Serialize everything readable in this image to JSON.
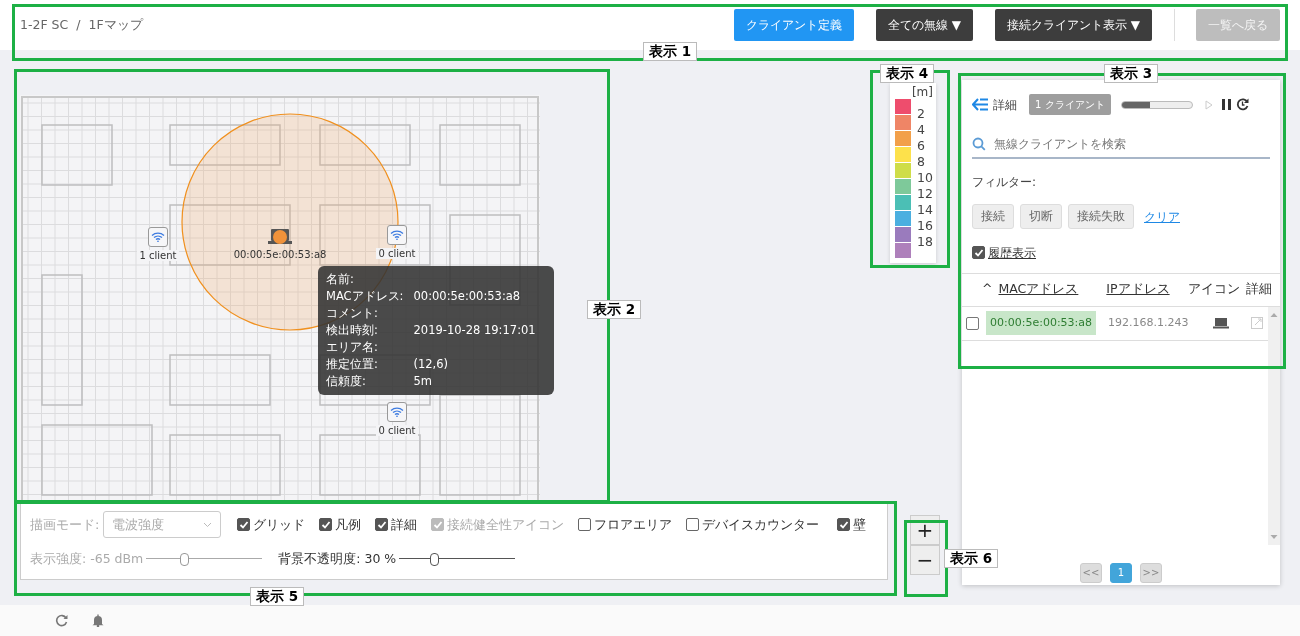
{
  "breadcrumb": {
    "separator": "/",
    "items": [
      {
        "label": "1-2F SC"
      },
      {
        "label": "1Fマップ"
      }
    ]
  },
  "toolbar": [
    {
      "label": "クライアント定義",
      "kind": "primary",
      "disabled": false
    },
    {
      "label": "全ての無線 ▼",
      "kind": "dropdown",
      "disabled": false
    },
    {
      "label": "接続クライアント表示 ▼",
      "kind": "dropdown",
      "disabled": false
    },
    {
      "label": "一覧へ戻る",
      "kind": "plain",
      "disabled": true
    }
  ],
  "map": {
    "access_points": [
      {
        "label": "1 client"
      },
      {
        "label": "0 client"
      },
      {
        "label": "0 client"
      }
    ],
    "client": {
      "label": "00:00:5e:00:53:a8"
    },
    "tooltip": [
      {
        "key": "名前:"
      },
      {
        "key": "MACアドレス:",
        "value": "00:00:5e:00:53:a8"
      },
      {
        "key": "コメント:"
      },
      {
        "key": "検出時刻:",
        "value": "2019-10-28 19:17:01"
      },
      {
        "key": "エリア名:"
      },
      {
        "key": "推定位置:",
        "value": "(12,6)"
      },
      {
        "key": "信頼度:",
        "value": "5m"
      }
    ]
  },
  "legend": {
    "unit": "[m]",
    "items": [
      {
        "label": "2",
        "color": "#ee4d6d"
      },
      {
        "label": "4",
        "color": "#ef8566"
      },
      {
        "label": "6",
        "color": "#f2a04a"
      },
      {
        "label": "8",
        "color": "#fde14b"
      },
      {
        "label": "10",
        "color": "#cfdd48"
      },
      {
        "label": "12",
        "color": "#7ec99a"
      },
      {
        "label": "14",
        "color": "#4bbfb5"
      },
      {
        "label": "16",
        "color": "#4bafe0"
      },
      {
        "label": "18",
        "color": "#9a7bbd"
      },
      {
        "color": "#ae80bb"
      }
    ]
  },
  "controls": {
    "draw_mode": {
      "label": "描画モード:",
      "value": "電波強度",
      "disabled": true
    },
    "checkboxes": [
      {
        "label": "グリッド",
        "checked": true,
        "disabled": false
      },
      {
        "label": "凡例",
        "checked": true,
        "disabled": false
      },
      {
        "label": "詳細",
        "checked": true,
        "disabled": false
      },
      {
        "label": "接続健全性アイコン",
        "checked": true,
        "disabled": true
      },
      {
        "label": "フロアエリア",
        "checked": false,
        "disabled": false
      },
      {
        "label": "デバイスカウンター",
        "checked": false,
        "disabled": false
      },
      {
        "label": "壁",
        "checked": true,
        "disabled": false
      }
    ],
    "sliders": [
      {
        "label": "表示強度: -65 dBm",
        "level": 0.33,
        "disabled": true
      },
      {
        "label": "背景不透明度: 30 %",
        "level": 0.31,
        "disabled": false
      }
    ]
  },
  "zoom": [
    "+",
    "−"
  ],
  "panel": {
    "title": "詳細",
    "badge": "1 クライアント",
    "progress": {
      "level": 0.4
    },
    "search": {
      "placeholder": "無線クライアントを検索"
    },
    "filter_label": "フィルター:",
    "filters": [
      {
        "label": "接続",
        "selected": false
      },
      {
        "label": "切断",
        "selected": false
      },
      {
        "label": "接続失敗",
        "selected": false
      }
    ],
    "clear": "クリア",
    "history": {
      "label": "履歴表示",
      "checked": true
    },
    "columns": [
      {
        "label": "MACアドレス",
        "sort": "^",
        "underline": true
      },
      {
        "label": "IPアドレス",
        "underline": true
      },
      {
        "label": "アイコン",
        "underline": false
      },
      {
        "label": "詳細",
        "underline": false
      }
    ],
    "rows": [
      {
        "mac": "00:00:5e:00:53:a8",
        "ip": "192.168.1.243",
        "selected": false
      }
    ],
    "pager": {
      "prev": "<<",
      "next": ">>",
      "pages": [
        {
          "label": "1",
          "selected": true
        }
      ]
    }
  },
  "annotations": [
    {
      "label": "表示 1"
    },
    {
      "label": "表示 2"
    },
    {
      "label": "表示 3"
    },
    {
      "label": "表示 4"
    },
    {
      "label": "表示 5"
    },
    {
      "label": "表示 6"
    }
  ]
}
